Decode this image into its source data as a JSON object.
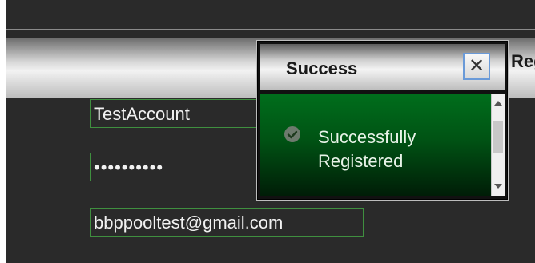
{
  "header": {
    "title": "Register"
  },
  "form": {
    "username_value": "TestAccount",
    "password_value": "••••••••••",
    "email_value": "bbppooltest@gmail.com"
  },
  "dialog": {
    "title": "Success",
    "message_line1": "Successfully",
    "message_line2": "Registered",
    "close_icon": "close-icon",
    "status_icon": "check-circle-icon"
  },
  "colors": {
    "field_border": "#3f8f3f",
    "dialog_body_top": "#006e1c",
    "page_background": "#2a2a2a"
  }
}
